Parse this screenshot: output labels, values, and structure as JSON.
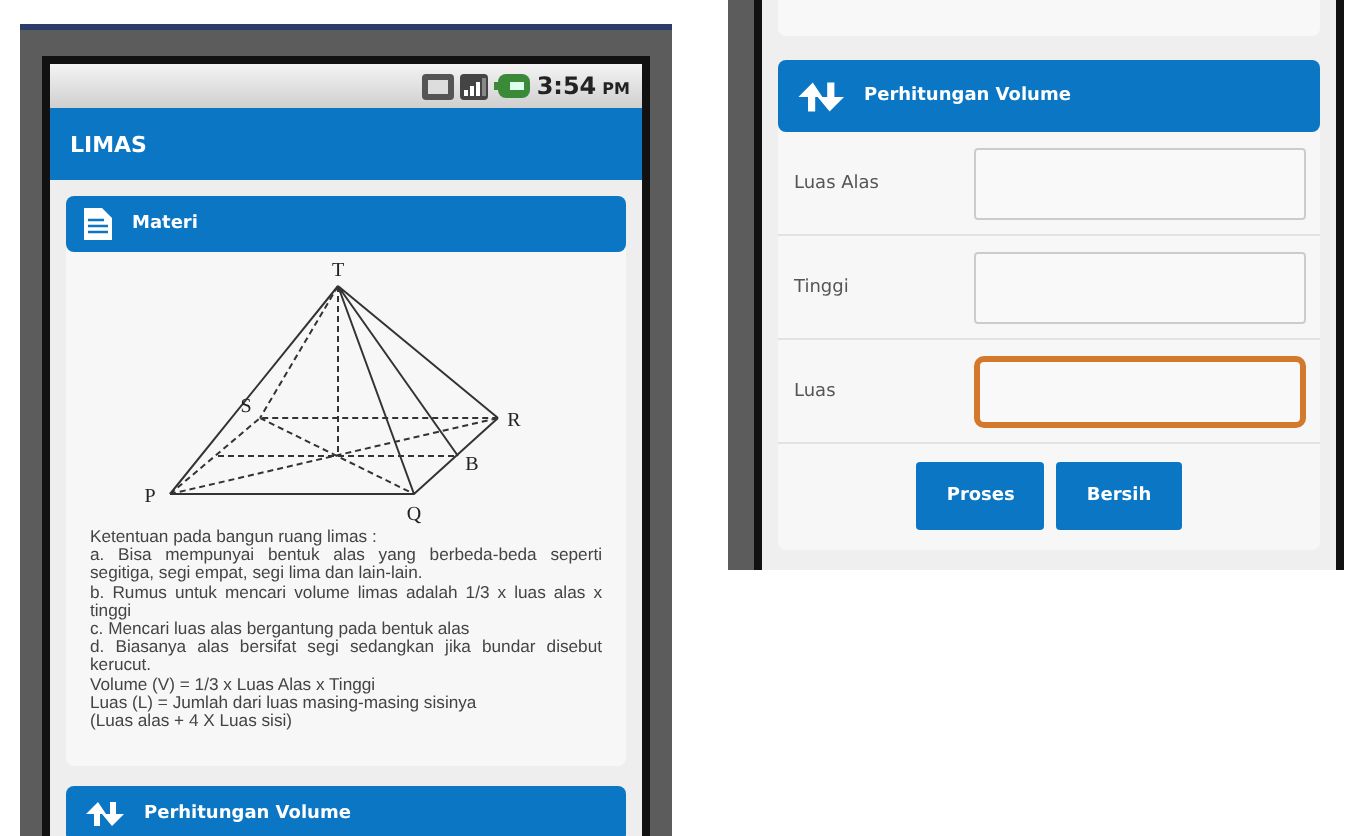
{
  "left_phone": {
    "status_bar": {
      "time": "3:54",
      "meridiem": "PM"
    },
    "app_bar": {
      "title": "LIMAS"
    },
    "materi_card": {
      "title": "Materi",
      "diagram_labels": [
        "T",
        "S",
        "R",
        "B",
        "Q",
        "P"
      ],
      "lines": [
        "Ketentuan pada bangun ruang limas :",
        "a. Bisa mempunyai bentuk alas yang berbeda-beda seperti segitiga, segi empat, segi lima dan lain-lain.",
        "b. Rumus untuk mencari volume limas adalah 1/3 x luas alas x tinggi",
        "c. Mencari luas alas bergantung pada bentuk alas",
        "d. Biasanya alas bersifat segi sedangkan jika bundar disebut kerucut.",
        "Volume (V) = 1/3 x Luas Alas x Tinggi",
        "Luas (L) = Jumlah dari luas masing-masing sisinya",
        "(Luas alas + 4 X Luas sisi)"
      ]
    },
    "next_card": {
      "title": "Perhitungan Volume"
    }
  },
  "right_phone": {
    "volume_card": {
      "title": "Perhitungan Volume",
      "fields": [
        {
          "label": "Luas Alas",
          "focused": false
        },
        {
          "label": "Tinggi",
          "focused": false
        },
        {
          "label": "Luas",
          "focused": true
        }
      ],
      "buttons": [
        "Proses",
        "Bersih"
      ]
    }
  }
}
